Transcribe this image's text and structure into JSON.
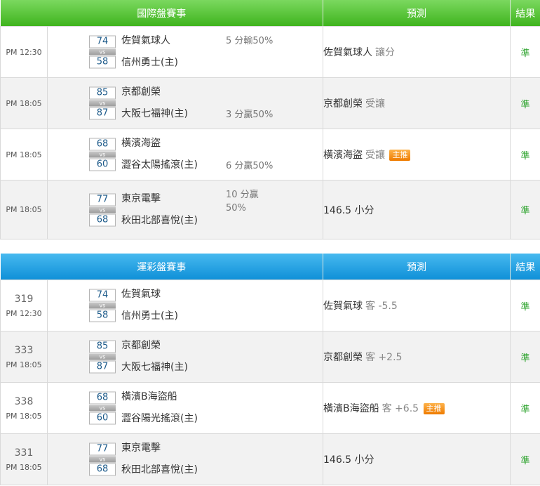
{
  "sections": [
    {
      "header": {
        "title": "國際盤賽事",
        "prediction": "預測",
        "result": "結果"
      },
      "rows": [
        {
          "id": "",
          "time": "PM 12:30",
          "score_away": "74",
          "score_home": "58",
          "vs": "vs",
          "away": "佐賀氣球人",
          "home": "信州勇士(主)",
          "handicap": "5 分輸50%",
          "pick": "佐賀氣球人",
          "pick_sub": "讓分",
          "badge": "",
          "result": "準"
        },
        {
          "id": "",
          "time": "PM 18:05",
          "score_away": "85",
          "score_home": "87",
          "vs": "vs",
          "away": "京都創榮",
          "home": "大阪七福神(主)",
          "handicap": "3 分贏50%",
          "pick": "京都創榮",
          "pick_sub": "受讓",
          "badge": "",
          "result": "準"
        },
        {
          "id": "",
          "time": "PM 18:05",
          "score_away": "68",
          "score_home": "60",
          "vs": "vs",
          "away": "橫濱海盜",
          "home": "澀谷太陽搖滾(主)",
          "handicap": "6 分贏50%",
          "pick": "橫濱海盜",
          "pick_sub": "受讓",
          "badge": "主推",
          "result": "準"
        },
        {
          "id": "",
          "time": "PM 18:05",
          "score_away": "77",
          "score_home": "68",
          "vs": "vs",
          "away": "東京電擊",
          "home": "秋田北部喜悅(主)",
          "handicap": "10 分贏50%",
          "pick": "146.5 小分",
          "pick_sub": "",
          "badge": "",
          "result": "準"
        }
      ]
    },
    {
      "header": {
        "title": "運彩盤賽事",
        "prediction": "預測",
        "result": "結果"
      },
      "rows": [
        {
          "id": "319",
          "time": "PM 12:30",
          "score_away": "74",
          "score_home": "58",
          "vs": "vs",
          "away": "佐賀氣球",
          "home": "信州勇士(主)",
          "handicap": "",
          "pick": "佐賀氣球",
          "pick_sub": "客 -5.5",
          "badge": "",
          "result": "準"
        },
        {
          "id": "333",
          "time": "PM 18:05",
          "score_away": "85",
          "score_home": "87",
          "vs": "vs",
          "away": "京都創榮",
          "home": "大阪七福神(主)",
          "handicap": "",
          "pick": "京都創榮",
          "pick_sub": "客 +2.5",
          "badge": "",
          "result": "準"
        },
        {
          "id": "338",
          "time": "PM 18:05",
          "score_away": "68",
          "score_home": "60",
          "vs": "vs",
          "away": "橫濱B海盜船",
          "home": "澀谷陽光搖滾(主)",
          "handicap": "",
          "pick": "橫濱B海盜船",
          "pick_sub": "客 +6.5",
          "badge": "主推",
          "result": "準"
        },
        {
          "id": "331",
          "time": "PM 18:05",
          "score_away": "77",
          "score_home": "68",
          "vs": "vs",
          "away": "東京電擊",
          "home": "秋田北部喜悅(主)",
          "handicap": "",
          "pick": "146.5 小分",
          "pick_sub": "",
          "badge": "",
          "result": "準"
        }
      ]
    }
  ]
}
